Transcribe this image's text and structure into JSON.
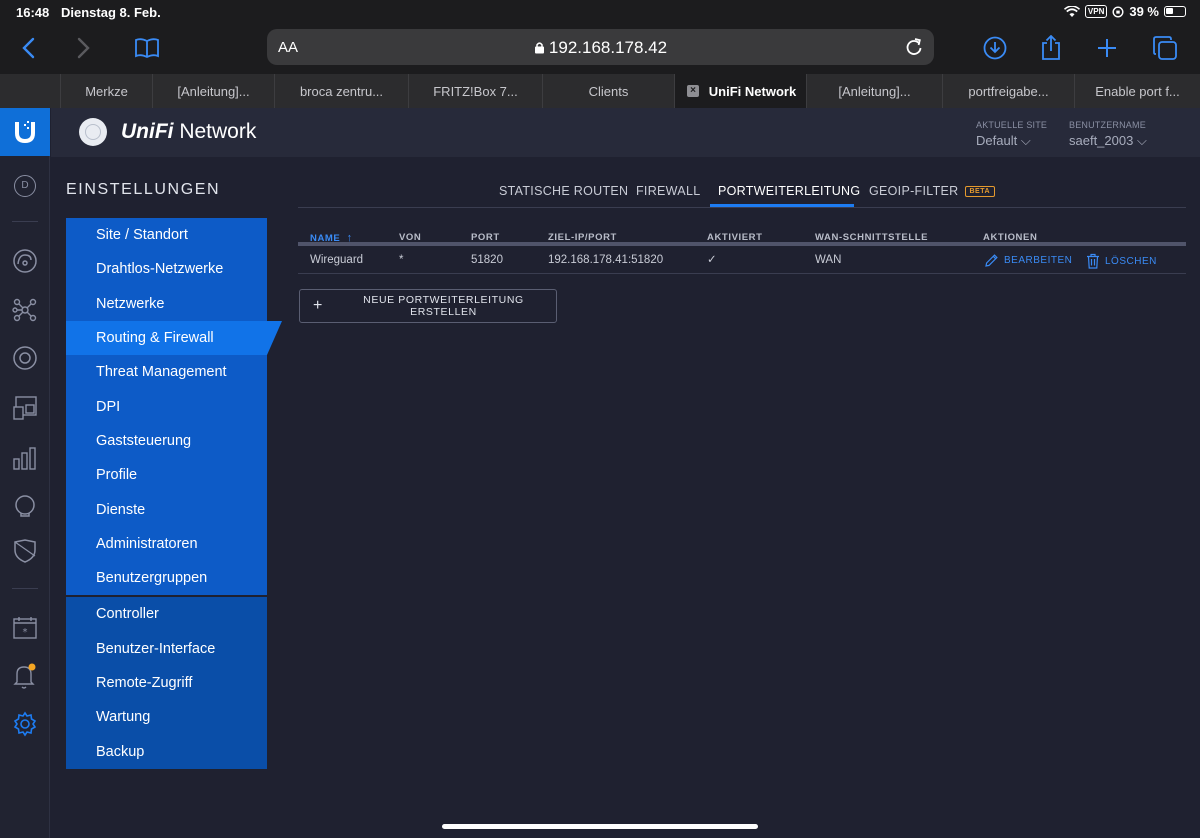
{
  "status": {
    "time": "16:48",
    "date": "Dienstag 8. Feb.",
    "vpn": "VPN",
    "battery": "39 %"
  },
  "browser": {
    "text_size": "AA",
    "url": "192.168.178.42",
    "tabs": [
      {
        "label": "Merkze"
      },
      {
        "label": "[Anleitung]..."
      },
      {
        "label": "broca zentru..."
      },
      {
        "label": "FRITZ!Box 7..."
      },
      {
        "label": "Clients"
      },
      {
        "label": "UniFi Network",
        "active": true
      },
      {
        "label": "[Anleitung]..."
      },
      {
        "label": "portfreigabe..."
      },
      {
        "label": "Enable port f..."
      }
    ]
  },
  "header": {
    "brand_unifi": "UniFi",
    "brand_network": " Network",
    "site_label": "AKTUELLE SITE",
    "site_value": "Default",
    "user_label": "BENUTZERNAME",
    "user_value": "saeft_2003"
  },
  "leftnav": {
    "avatar_letter": "D"
  },
  "settings": {
    "title": "EINSTELLUNGEN",
    "menu_upper": [
      "Site / Standort",
      "Drahtlos-Netzwerke",
      "Netzwerke",
      "Routing & Firewall",
      "Threat Management",
      "DPI",
      "Gaststeuerung",
      "Profile",
      "Dienste",
      "Administratoren",
      "Benutzergruppen"
    ],
    "menu_lower": [
      "Controller",
      "Benutzer-Interface",
      "Remote-Zugriff",
      "Wartung",
      "Backup"
    ],
    "active_item": "Routing & Firewall"
  },
  "subtabs": {
    "static": "STATISCHE ROUTEN",
    "firewall": "FIREWALL",
    "portfwd": "PORTWEITERLEITUNG",
    "geoip": "GEOIP-FILTER",
    "beta": "BETA"
  },
  "table": {
    "headers": {
      "name": "NAME",
      "sort": "↑",
      "from": "VON",
      "port": "PORT",
      "target": "ZIEL-IP/PORT",
      "enabled": "AKTIVIERT",
      "wan": "WAN-SCHNITTSTELLE",
      "actions": "AKTIONEN"
    },
    "rows": [
      {
        "name": "Wireguard",
        "from": "*",
        "port": "51820",
        "target": "192.168.178.41:51820",
        "enabled": "✓",
        "wan": "WAN",
        "edit": "BEARBEITEN",
        "delete": "LÖSCHEN"
      }
    ]
  },
  "create_button": "NEUE PORTWEITERLEITUNG ERSTELLEN",
  "colors": {
    "accent": "#1d7cf2",
    "menu": "#0d5bc7",
    "menu_active": "#1173e8",
    "beta": "#e59a2e",
    "notify_dot": "#f5a623"
  }
}
